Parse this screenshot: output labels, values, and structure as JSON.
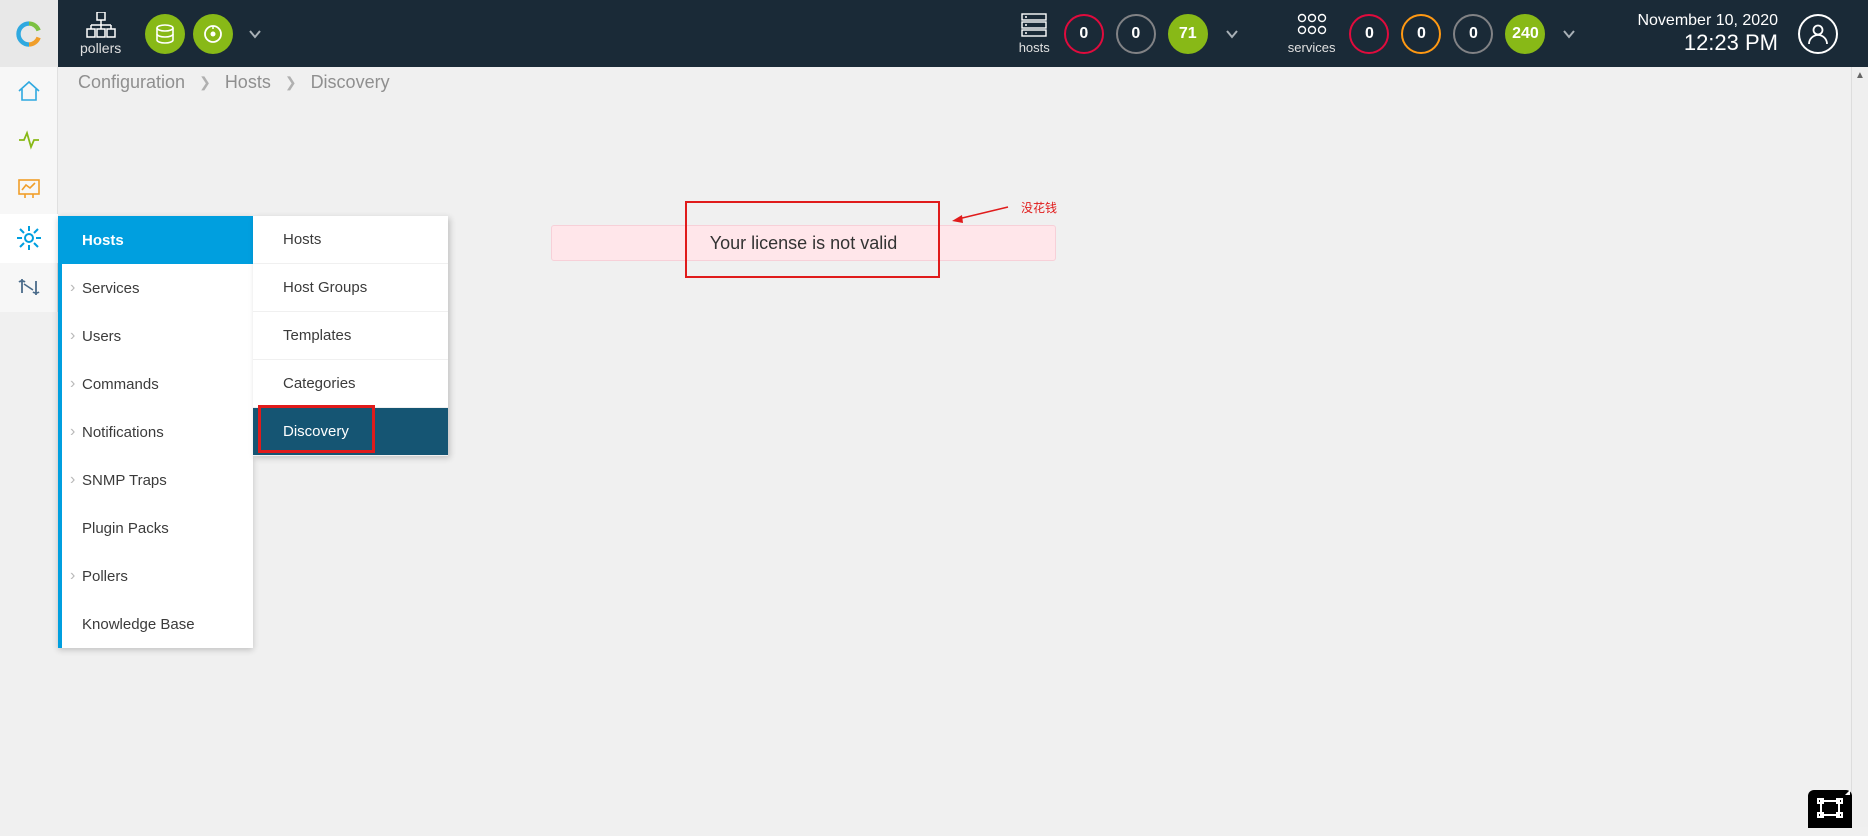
{
  "header": {
    "pollers_label": "pollers",
    "hosts_label": "hosts",
    "services_label": "services",
    "hosts_counts": {
      "red": "0",
      "gray": "0",
      "green": "71"
    },
    "services_counts": {
      "red": "0",
      "orange": "0",
      "gray": "0",
      "green": "240"
    },
    "date": "November 10, 2020",
    "time": "12:23 PM"
  },
  "breadcrumb": {
    "a": "Configuration",
    "b": "Hosts",
    "c": "Discovery"
  },
  "menu1": {
    "items": [
      "Hosts",
      "Services",
      "Users",
      "Commands",
      "Notifications",
      "SNMP Traps",
      "Plugin Packs",
      "Pollers",
      "Knowledge Base"
    ]
  },
  "menu2": {
    "items": [
      "Hosts",
      "Host Groups",
      "Templates",
      "Categories",
      "Discovery"
    ]
  },
  "error_message": "Your license is not valid",
  "annotation_text": "没花钱"
}
